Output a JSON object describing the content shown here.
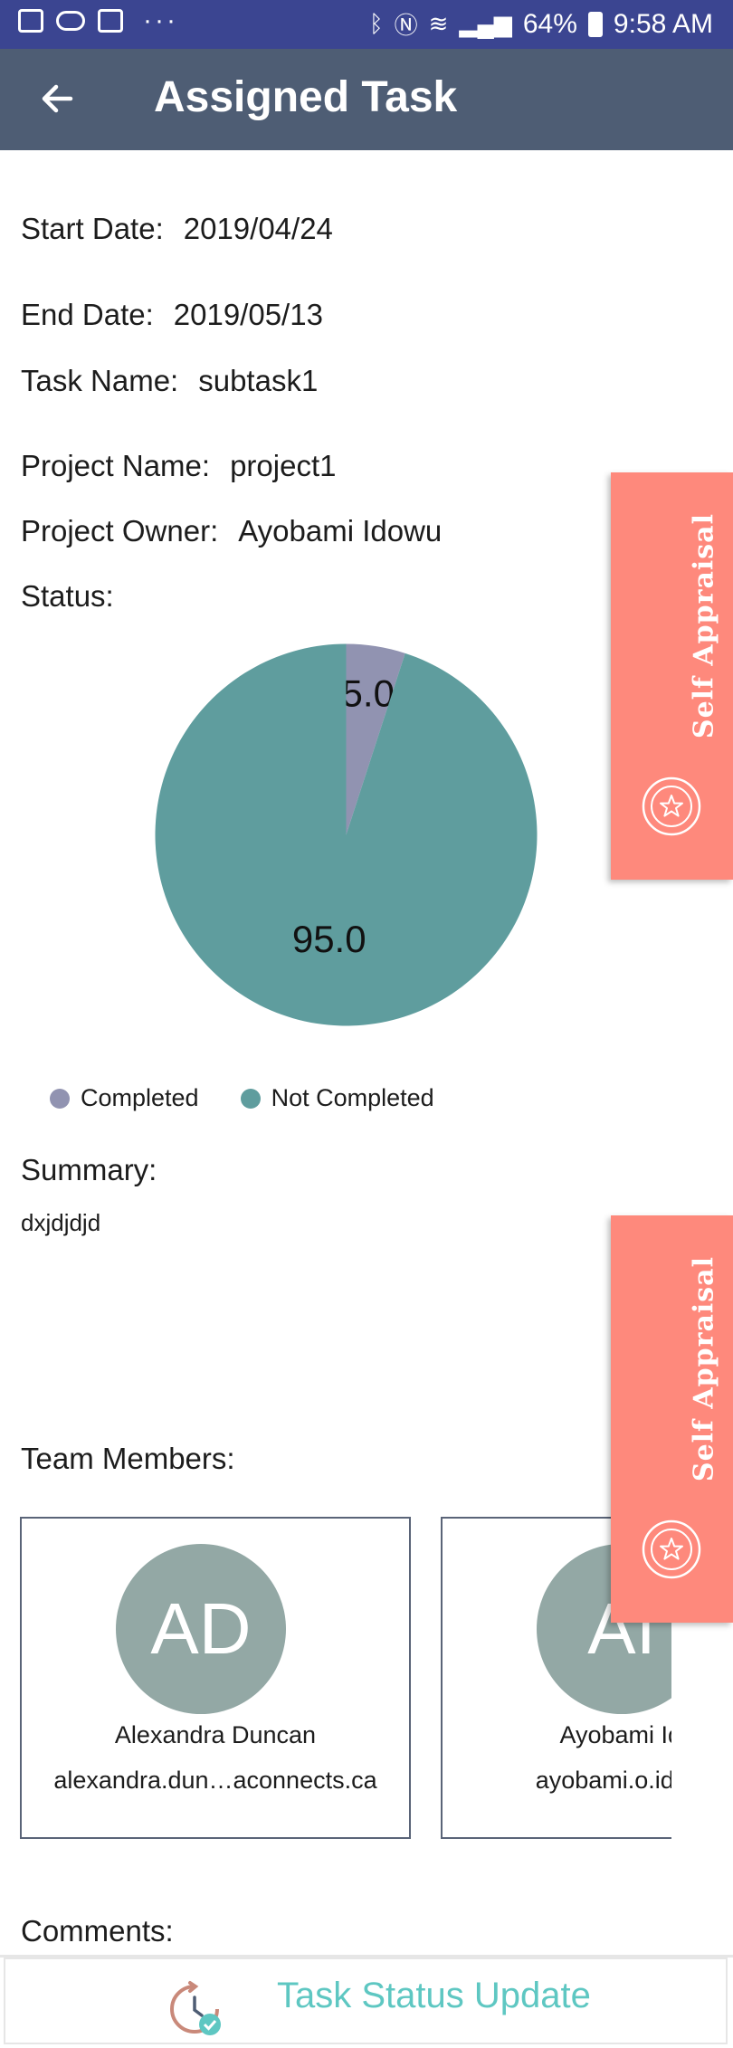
{
  "status_bar": {
    "battery": "64%",
    "time": "9:58 AM"
  },
  "app_bar": {
    "title": "Assigned Task"
  },
  "task": {
    "start_label": "Start Date:",
    "start_value": "2019/04/24",
    "end_label": "End Date:",
    "end_value": "2019/05/13",
    "name_label": "Task Name:",
    "name_value": "subtask1",
    "project_label": "Project Name:",
    "project_value": "project1",
    "owner_label": "Project Owner:",
    "owner_value": "Ayobami Idowu",
    "status_label": "Status:"
  },
  "chart_data": {
    "type": "pie",
    "slices": [
      {
        "label": "Completed",
        "value": 5.0,
        "display": "5.0",
        "color": "#9193b1"
      },
      {
        "label": "Not Completed",
        "value": 95.0,
        "display": "95.0",
        "color": "#5f9d9e"
      }
    ],
    "legend_position": "bottom-left"
  },
  "summary": {
    "label": "Summary:",
    "text": "dxjdjdjd"
  },
  "team": {
    "label": "Team Members:",
    "members": [
      {
        "initials": "AD",
        "name": "Alexandra Duncan",
        "email": "alexandra.dun…aconnects.ca"
      },
      {
        "initials": "AI",
        "name": "Ayobami Idow",
        "email": "ayobami.o.ido…@"
      }
    ]
  },
  "comments": {
    "label": "Comments:"
  },
  "self_appraisal": {
    "label": "Self Appraisal"
  },
  "bottom_bar": {
    "label": "Task Status Update"
  },
  "colors": {
    "appbar": "#4e5d74",
    "statusbar": "#3b4591",
    "appraisal": "#fe897c",
    "accent": "#5ec7c2"
  }
}
